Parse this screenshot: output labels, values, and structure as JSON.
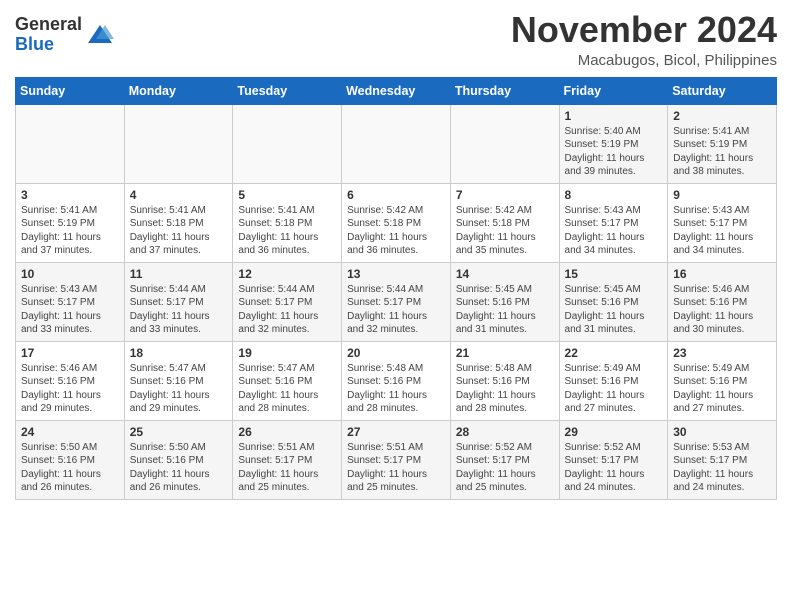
{
  "logo": {
    "general": "General",
    "blue": "Blue"
  },
  "title": "November 2024",
  "location": "Macabugos, Bicol, Philippines",
  "weekdays": [
    "Sunday",
    "Monday",
    "Tuesday",
    "Wednesday",
    "Thursday",
    "Friday",
    "Saturday"
  ],
  "weeks": [
    [
      {
        "day": "",
        "info": ""
      },
      {
        "day": "",
        "info": ""
      },
      {
        "day": "",
        "info": ""
      },
      {
        "day": "",
        "info": ""
      },
      {
        "day": "",
        "info": ""
      },
      {
        "day": "1",
        "info": "Sunrise: 5:40 AM\nSunset: 5:19 PM\nDaylight: 11 hours and 39 minutes."
      },
      {
        "day": "2",
        "info": "Sunrise: 5:41 AM\nSunset: 5:19 PM\nDaylight: 11 hours and 38 minutes."
      }
    ],
    [
      {
        "day": "3",
        "info": "Sunrise: 5:41 AM\nSunset: 5:19 PM\nDaylight: 11 hours and 37 minutes."
      },
      {
        "day": "4",
        "info": "Sunrise: 5:41 AM\nSunset: 5:18 PM\nDaylight: 11 hours and 37 minutes."
      },
      {
        "day": "5",
        "info": "Sunrise: 5:41 AM\nSunset: 5:18 PM\nDaylight: 11 hours and 36 minutes."
      },
      {
        "day": "6",
        "info": "Sunrise: 5:42 AM\nSunset: 5:18 PM\nDaylight: 11 hours and 36 minutes."
      },
      {
        "day": "7",
        "info": "Sunrise: 5:42 AM\nSunset: 5:18 PM\nDaylight: 11 hours and 35 minutes."
      },
      {
        "day": "8",
        "info": "Sunrise: 5:43 AM\nSunset: 5:17 PM\nDaylight: 11 hours and 34 minutes."
      },
      {
        "day": "9",
        "info": "Sunrise: 5:43 AM\nSunset: 5:17 PM\nDaylight: 11 hours and 34 minutes."
      }
    ],
    [
      {
        "day": "10",
        "info": "Sunrise: 5:43 AM\nSunset: 5:17 PM\nDaylight: 11 hours and 33 minutes."
      },
      {
        "day": "11",
        "info": "Sunrise: 5:44 AM\nSunset: 5:17 PM\nDaylight: 11 hours and 33 minutes."
      },
      {
        "day": "12",
        "info": "Sunrise: 5:44 AM\nSunset: 5:17 PM\nDaylight: 11 hours and 32 minutes."
      },
      {
        "day": "13",
        "info": "Sunrise: 5:44 AM\nSunset: 5:17 PM\nDaylight: 11 hours and 32 minutes."
      },
      {
        "day": "14",
        "info": "Sunrise: 5:45 AM\nSunset: 5:16 PM\nDaylight: 11 hours and 31 minutes."
      },
      {
        "day": "15",
        "info": "Sunrise: 5:45 AM\nSunset: 5:16 PM\nDaylight: 11 hours and 31 minutes."
      },
      {
        "day": "16",
        "info": "Sunrise: 5:46 AM\nSunset: 5:16 PM\nDaylight: 11 hours and 30 minutes."
      }
    ],
    [
      {
        "day": "17",
        "info": "Sunrise: 5:46 AM\nSunset: 5:16 PM\nDaylight: 11 hours and 29 minutes."
      },
      {
        "day": "18",
        "info": "Sunrise: 5:47 AM\nSunset: 5:16 PM\nDaylight: 11 hours and 29 minutes."
      },
      {
        "day": "19",
        "info": "Sunrise: 5:47 AM\nSunset: 5:16 PM\nDaylight: 11 hours and 28 minutes."
      },
      {
        "day": "20",
        "info": "Sunrise: 5:48 AM\nSunset: 5:16 PM\nDaylight: 11 hours and 28 minutes."
      },
      {
        "day": "21",
        "info": "Sunrise: 5:48 AM\nSunset: 5:16 PM\nDaylight: 11 hours and 28 minutes."
      },
      {
        "day": "22",
        "info": "Sunrise: 5:49 AM\nSunset: 5:16 PM\nDaylight: 11 hours and 27 minutes."
      },
      {
        "day": "23",
        "info": "Sunrise: 5:49 AM\nSunset: 5:16 PM\nDaylight: 11 hours and 27 minutes."
      }
    ],
    [
      {
        "day": "24",
        "info": "Sunrise: 5:50 AM\nSunset: 5:16 PM\nDaylight: 11 hours and 26 minutes."
      },
      {
        "day": "25",
        "info": "Sunrise: 5:50 AM\nSunset: 5:16 PM\nDaylight: 11 hours and 26 minutes."
      },
      {
        "day": "26",
        "info": "Sunrise: 5:51 AM\nSunset: 5:17 PM\nDaylight: 11 hours and 25 minutes."
      },
      {
        "day": "27",
        "info": "Sunrise: 5:51 AM\nSunset: 5:17 PM\nDaylight: 11 hours and 25 minutes."
      },
      {
        "day": "28",
        "info": "Sunrise: 5:52 AM\nSunset: 5:17 PM\nDaylight: 11 hours and 25 minutes."
      },
      {
        "day": "29",
        "info": "Sunrise: 5:52 AM\nSunset: 5:17 PM\nDaylight: 11 hours and 24 minutes."
      },
      {
        "day": "30",
        "info": "Sunrise: 5:53 AM\nSunset: 5:17 PM\nDaylight: 11 hours and 24 minutes."
      }
    ]
  ]
}
